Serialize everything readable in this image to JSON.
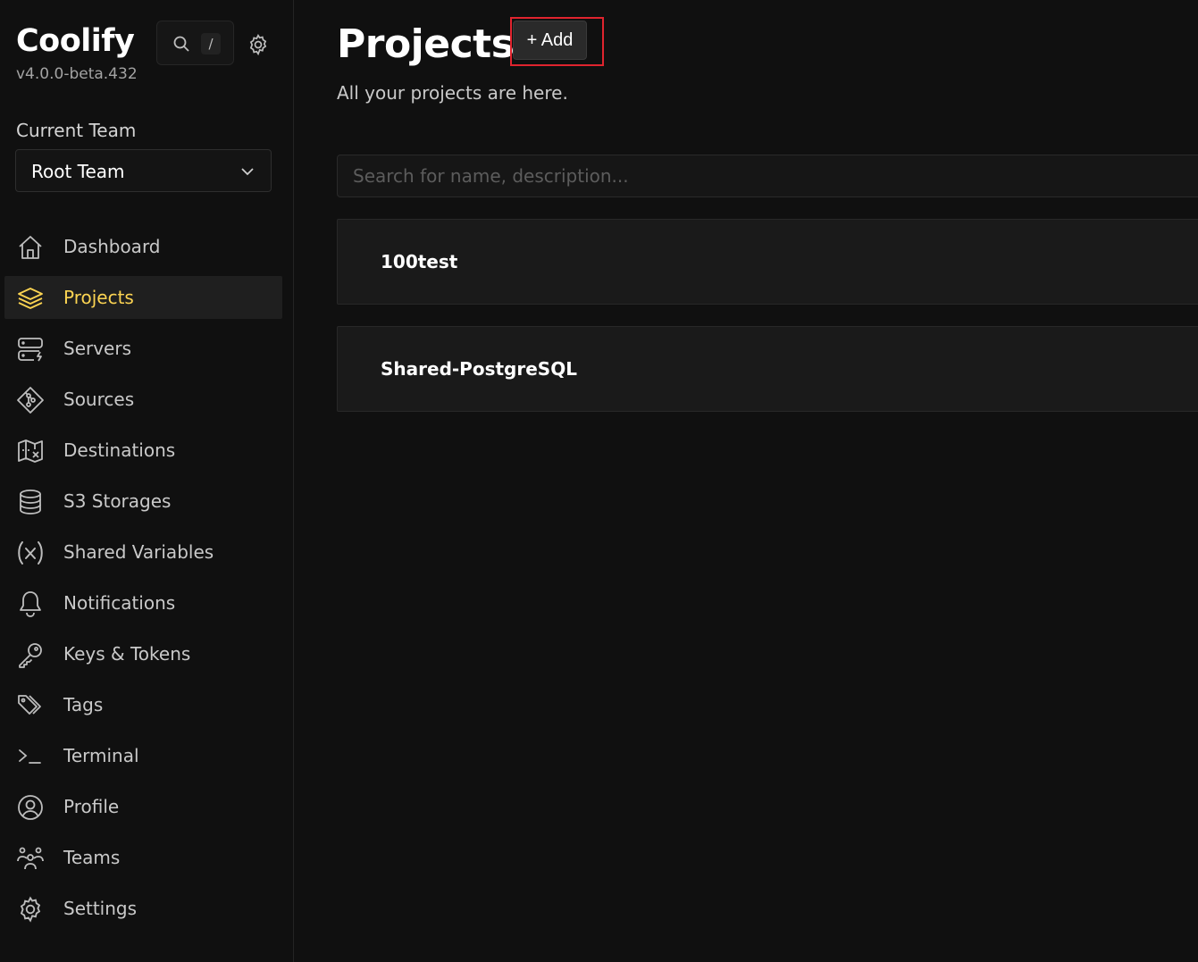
{
  "brand": {
    "name": "Coolify",
    "version": "v4.0.0-beta.432"
  },
  "search_shortcut": {
    "key": "/",
    "icon": "search-icon"
  },
  "team": {
    "label": "Current Team",
    "selected": "Root Team"
  },
  "nav": {
    "items": [
      {
        "label": "Dashboard",
        "icon": "home-icon",
        "active": false
      },
      {
        "label": "Projects",
        "icon": "layers-icon",
        "active": true
      },
      {
        "label": "Servers",
        "icon": "server-icon",
        "active": false
      },
      {
        "label": "Sources",
        "icon": "git-icon",
        "active": false
      },
      {
        "label": "Destinations",
        "icon": "map-icon",
        "active": false
      },
      {
        "label": "S3 Storages",
        "icon": "database-icon",
        "active": false
      },
      {
        "label": "Shared Variables",
        "icon": "variable-icon",
        "active": false
      },
      {
        "label": "Notifications",
        "icon": "bell-icon",
        "active": false
      },
      {
        "label": "Keys & Tokens",
        "icon": "key-icon",
        "active": false
      },
      {
        "label": "Tags",
        "icon": "tag-icon",
        "active": false
      },
      {
        "label": "Terminal",
        "icon": "terminal-icon",
        "active": false
      },
      {
        "label": "Profile",
        "icon": "profile-icon",
        "active": false
      },
      {
        "label": "Teams",
        "icon": "users-icon",
        "active": false
      },
      {
        "label": "Settings",
        "icon": "gear-icon",
        "active": false
      }
    ]
  },
  "main": {
    "title": "Projects",
    "add_label": "+ Add",
    "subtitle": "All your projects are here.",
    "search_placeholder": "Search for name, description...",
    "projects": [
      {
        "name": "100test"
      },
      {
        "name": "Shared-PostgreSQL"
      }
    ]
  },
  "colors": {
    "background": "#101010",
    "accent": "#fcd452",
    "highlight": "#e0242e"
  }
}
